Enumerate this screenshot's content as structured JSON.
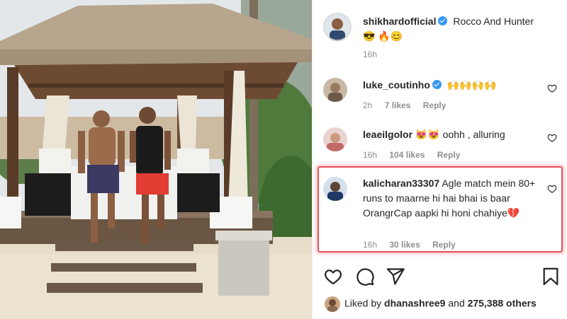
{
  "post": {
    "author": "shikhardofficial",
    "caption": "Rocco And Hunter 😎 🔥😊",
    "time": "16h"
  },
  "comments": [
    {
      "username": "luke_coutinho",
      "verified": true,
      "text": "🙌🙌🙌🙌",
      "time": "2h",
      "likes": "7 likes",
      "reply": "Reply"
    },
    {
      "username": "leaeilgolor",
      "verified": false,
      "text": "😻😻 oohh , alluring",
      "time": "16h",
      "likes": "104 likes",
      "reply": "Reply"
    },
    {
      "username": "kalicharan33307",
      "verified": false,
      "text": "Agle match mein 80+ runs to maarne hi hai bhai is baar OrangrCap aapki hi honi chahiye💔",
      "time": "16h",
      "likes": "30 likes",
      "reply": "Reply"
    }
  ],
  "likes_summary": {
    "prefix": "Liked by",
    "user": "dhanashree9",
    "middle": "and",
    "count": "275,388 others"
  },
  "icons": [
    "heart-icon",
    "comment-icon",
    "share-icon",
    "bookmark-icon"
  ],
  "colors": {
    "highlight": "#e8505b",
    "verified": "#3897f0",
    "meta": "#8e8e8e"
  }
}
